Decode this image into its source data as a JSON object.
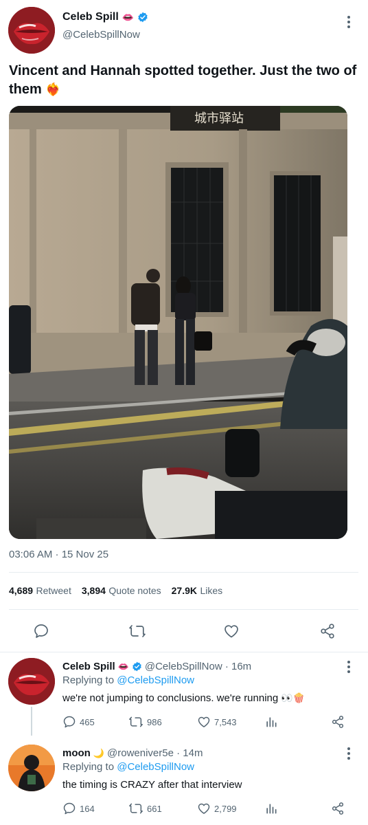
{
  "tweet": {
    "author_name": "Celeb Spill",
    "author_emoji": "👄",
    "author_handle": "@CelebSpillNow",
    "text": "Vincent and Hannah spotted together. Just the two of them",
    "text_emoji": "❤️‍🔥",
    "photo_signage": "城市驿站",
    "timestamp": "03:06 AM · 15 Nov 25"
  },
  "stats": {
    "retweets_count": "4,689",
    "retweets_label": "Retweet",
    "quotes_count": "3,894",
    "quotes_label": "Quote notes",
    "likes_count": "27.9K",
    "likes_label": "Likes"
  },
  "replies": [
    {
      "name": "Celeb Spill",
      "name_emoji": "👄",
      "handle_time": "@CelebSpillNow · 16m",
      "replying_prefix": "Replying to",
      "replying_to": "@CelebSpillNow",
      "text": "we're not jumping to conclusions. we're running",
      "text_emoji": "👀🍿",
      "replies": "465",
      "retweets": "986",
      "likes": "7,543"
    },
    {
      "name": "moon",
      "name_emoji": "🌙",
      "handle_time": "@roweniver5e · 14m",
      "replying_prefix": "Replying to",
      "replying_to": "@CelebSpillNow",
      "text": "the timing is CRAZY after that interview",
      "replies": "164",
      "retweets": "661",
      "likes": "2,799"
    }
  ],
  "colors": {
    "accent": "#1d9bf0",
    "verified": "#1d9bf0",
    "muted": "#536471"
  }
}
